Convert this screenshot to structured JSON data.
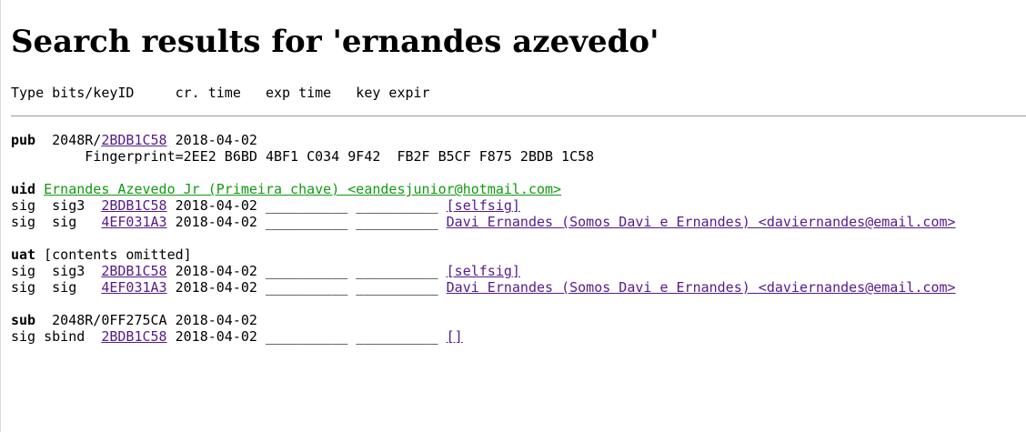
{
  "page": {
    "title": "Search results for 'ernandes azevedo'"
  },
  "columns": {
    "header": "Type bits/keyID     cr. time   exp time   key expir"
  },
  "pub": {
    "type": "pub",
    "bits": "2048R/",
    "keyid": "2BDB1C58",
    "created": "2018-04-02",
    "fingerprint_line": "         Fingerprint=2EE2 B6BD 4BF1 C034 9F42  FB2F B5CF F875 2BDB 1C58"
  },
  "uid": {
    "type": "uid",
    "name": "Ernandes Azevedo Jr (Primeira chave) <eandesjunior@hotmail.com>",
    "sigs": [
      {
        "prefix": "sig  sig3  ",
        "keyid": "2BDB1C58",
        "mid": " 2018-04-02 __________ __________ ",
        "signer": "[selfsig]"
      },
      {
        "prefix": "sig  sig   ",
        "keyid": "4EF031A3",
        "mid": " 2018-04-02 __________ __________ ",
        "signer": "Davi Ernandes (Somos Davi e Ernandes) <daviernandes@email.com>"
      }
    ]
  },
  "uat": {
    "type": "uat",
    "rest": " [contents omitted]",
    "sigs": [
      {
        "prefix": "sig  sig3  ",
        "keyid": "2BDB1C58",
        "mid": " 2018-04-02 __________ __________ ",
        "signer": "[selfsig]"
      },
      {
        "prefix": "sig  sig   ",
        "keyid": "4EF031A3",
        "mid": " 2018-04-02 __________ __________ ",
        "signer": "Davi Ernandes (Somos Davi e Ernandes) <daviernandes@email.com>"
      }
    ]
  },
  "sub": {
    "type": "sub",
    "rest": "  2048R/0FF275CA 2018-04-02",
    "sigs": [
      {
        "prefix": "sig sbind  ",
        "keyid": "2BDB1C58",
        "mid": " 2018-04-02 __________ __________ ",
        "signer": "[]"
      }
    ]
  },
  "colors": {
    "link": "#551a8b",
    "uid_link": "#119911",
    "rule": "#999999"
  }
}
